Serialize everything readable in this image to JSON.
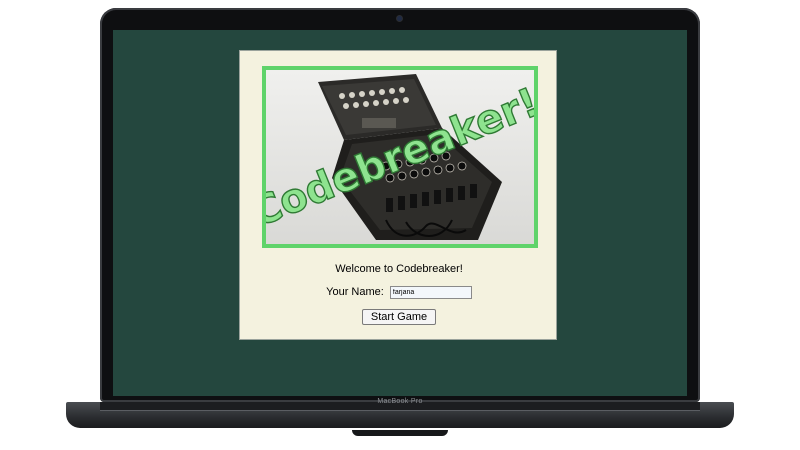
{
  "device": {
    "brand_label": "MacBook Pro"
  },
  "app": {
    "logo_text": "Codebreaker!",
    "welcome_text": "Welcome to Codebreaker!",
    "name_label": "Your Name:",
    "name_value": "farjana",
    "start_button_label": "Start Game"
  },
  "colors": {
    "screen_background": "#24473e",
    "panel_background": "#f4f2df",
    "logo_frame": "#5fd36a",
    "logo_text_fill": "#8ee38f"
  }
}
